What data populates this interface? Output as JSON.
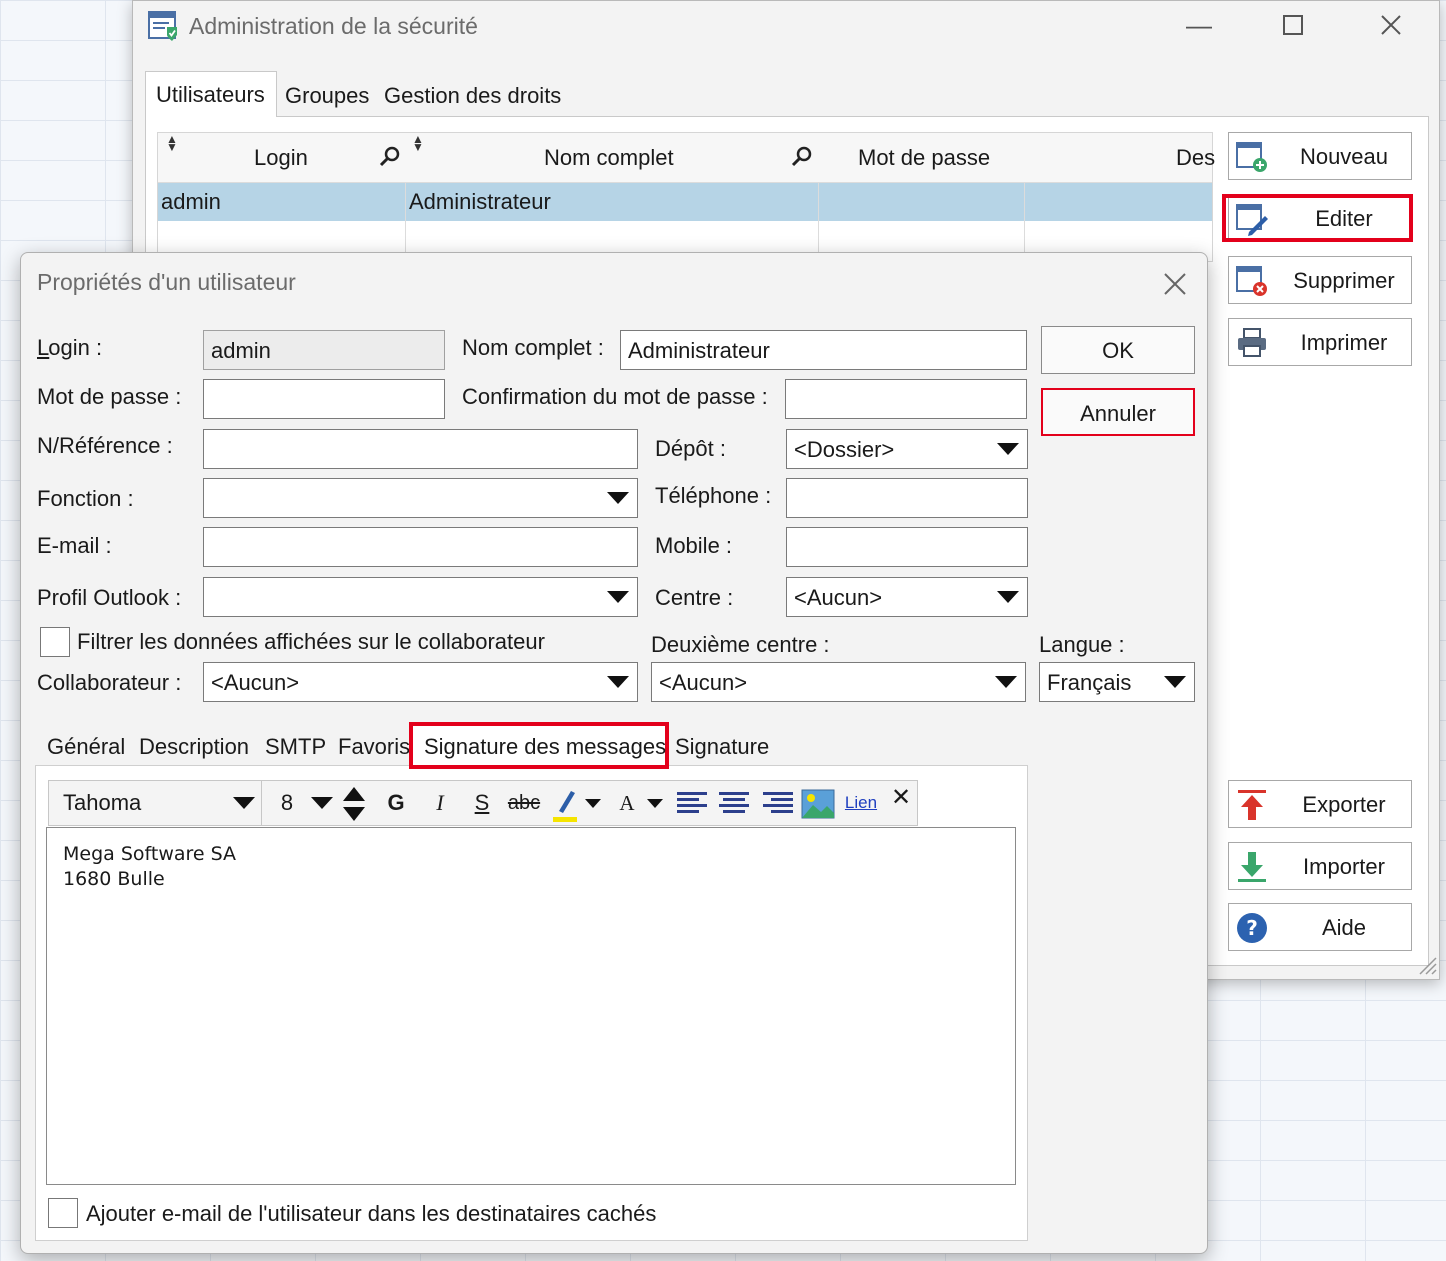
{
  "admin_window": {
    "title": "Administration de la sécurité",
    "tabs": [
      "Utilisateurs",
      "Groupes",
      "Gestion des droits"
    ],
    "active_tab": "Utilisateurs",
    "grid": {
      "columns": [
        "Login",
        "Nom complet",
        "Mot de passe",
        "Des"
      ],
      "rows": [
        {
          "login": "admin",
          "nom_complet": "Administrateur",
          "mot_de_passe": "",
          "description": ""
        }
      ]
    },
    "side_buttons": [
      "Nouveau",
      "Editer",
      "Supprimer",
      "Imprimer",
      "Exporter",
      "Importer",
      "Aide"
    ],
    "highlighted_button": "Editer"
  },
  "dialog": {
    "title": "Propriétés d'un utilisateur",
    "labels": {
      "login": "Login :",
      "nom_complet": "Nom complet :",
      "mot_de_passe": "Mot de passe :",
      "confirmation": "Confirmation du mot de passe :",
      "reference": "N/Référence :",
      "depot": "Dépôt :",
      "fonction": "Fonction :",
      "telephone": "Téléphone :",
      "email": "E-mail :",
      "mobile": "Mobile :",
      "profil_outlook": "Profil Outlook :",
      "centre": "Centre :",
      "filtrer": "Filtrer les données affichées sur le collaborateur",
      "deuxieme_centre": "Deuxième centre :",
      "langue": "Langue :",
      "collaborateur": "Collaborateur :"
    },
    "values": {
      "login": "admin",
      "nom_complet": "Administrateur",
      "mot_de_passe": "",
      "confirmation": "",
      "reference": "",
      "depot": "<Dossier>",
      "fonction": "",
      "telephone": "",
      "email": "",
      "mobile": "",
      "profil_outlook": "",
      "centre": "<Aucun>",
      "filtrer_checked": false,
      "deuxieme_centre": "<Aucun>",
      "langue": "Français",
      "collaborateur": "<Aucun>"
    },
    "buttons": {
      "ok": "OK",
      "annuler": "Annuler"
    },
    "tabs": [
      "Général",
      "Description",
      "SMTP",
      "Favoris",
      "Signature des messages",
      "Signature"
    ],
    "active_tab": "Signature des messages",
    "toolbar": {
      "font": "Tahoma",
      "size": "8",
      "bold": "G",
      "italic": "I",
      "underline": "S",
      "strike": "abc",
      "font_color": "A",
      "link": "Lien",
      "clear": "✕"
    },
    "signature_lines": [
      "Mega Software SA",
      "1680 Bulle"
    ],
    "bcc_checkbox_label": "Ajouter e-mail de l'utilisateur dans les destinataires cachés",
    "bcc_checked": false
  },
  "colors": {
    "highlight": "#e3001b",
    "selected_row": "#b6d4e6"
  }
}
